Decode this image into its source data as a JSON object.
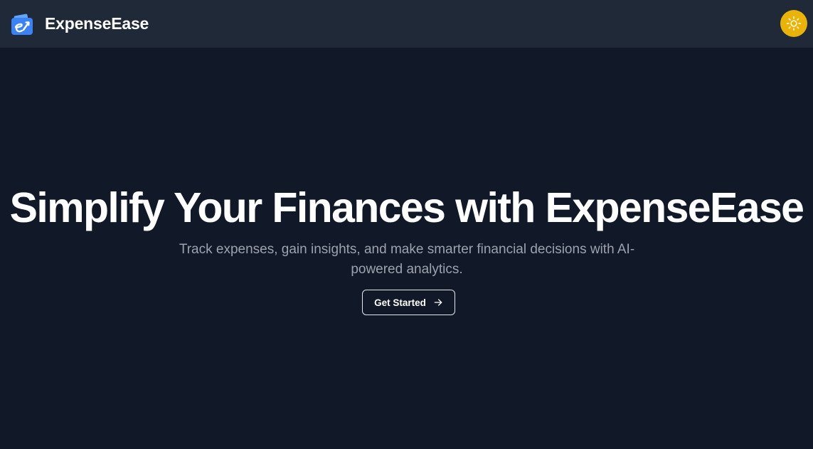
{
  "navbar": {
    "brand_name": "ExpenseEase",
    "logo_icon": "wallet-e-icon",
    "theme_toggle_icon": "sun-icon"
  },
  "hero": {
    "title": "Simplify Your Finances with ExpenseEase",
    "subtitle": "Track expenses, gain insights, and make smarter financial decisions with AI-powered analytics.",
    "cta_label": "Get Started",
    "cta_icon": "arrow-right-icon"
  },
  "colors": {
    "page_background": "#111827",
    "navbar_background": "#1f2937",
    "logo_blue": "#3b82f6",
    "theme_toggle": "#eab308",
    "title_text": "#ffffff",
    "subtitle_text": "#9ca3af",
    "button_border": "#e5e7eb"
  }
}
